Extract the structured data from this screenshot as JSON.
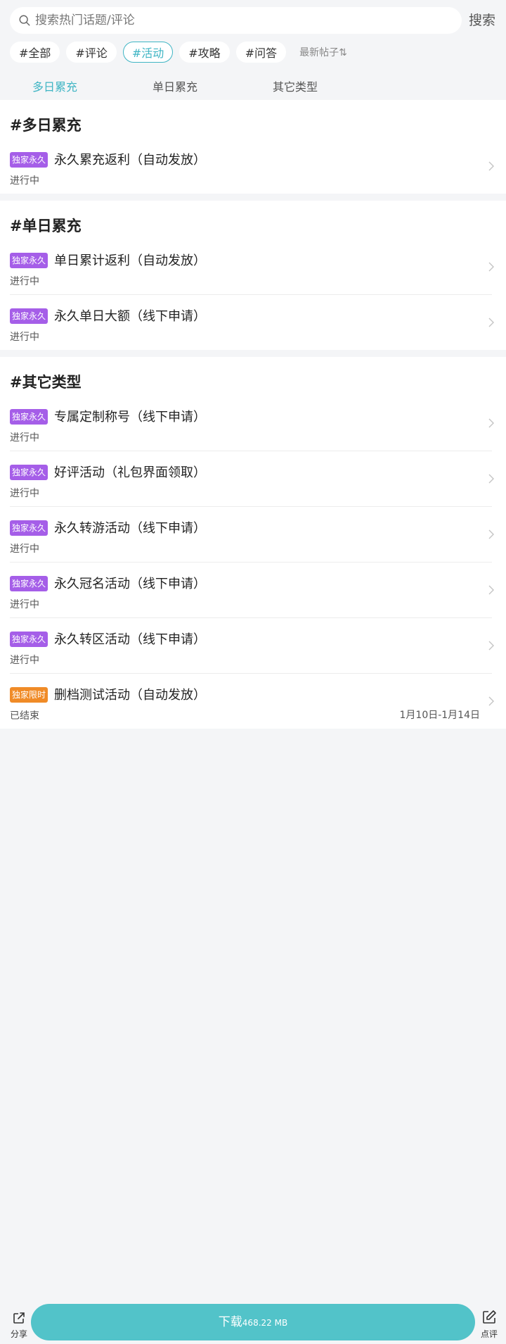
{
  "search": {
    "placeholder": "搜索热门话题/评论",
    "button": "搜索"
  },
  "tags": [
    {
      "label": "#全部",
      "active": false
    },
    {
      "label": "#评论",
      "active": false
    },
    {
      "label": "#活动",
      "active": true
    },
    {
      "label": "#攻略",
      "active": false
    },
    {
      "label": "#问答",
      "active": false
    }
  ],
  "sort": {
    "label": "最新帖子⇅"
  },
  "subtabs": [
    {
      "label": "多日累充",
      "active": true
    },
    {
      "label": "单日累充",
      "active": false
    },
    {
      "label": "其它类型",
      "active": false
    }
  ],
  "sections": [
    {
      "title": "#多日累充",
      "items": [
        {
          "badge": "独家永久",
          "badge_color": "#a55ee8",
          "title": "永久累充返利（自动发放）",
          "status": "进行中",
          "date": ""
        }
      ]
    },
    {
      "title": "#单日累充",
      "items": [
        {
          "badge": "独家永久",
          "badge_color": "#a55ee8",
          "title": "单日累计返利（自动发放）",
          "status": "进行中",
          "date": ""
        },
        {
          "badge": "独家永久",
          "badge_color": "#a55ee8",
          "title": "永久单日大额（线下申请）",
          "status": "进行中",
          "date": ""
        }
      ]
    },
    {
      "title": "#其它类型",
      "items": [
        {
          "badge": "独家永久",
          "badge_color": "#a55ee8",
          "title": "专属定制称号（线下申请）",
          "status": "进行中",
          "date": ""
        },
        {
          "badge": "独家永久",
          "badge_color": "#a55ee8",
          "title": "好评活动（礼包界面领取）",
          "status": "进行中",
          "date": ""
        },
        {
          "badge": "独家永久",
          "badge_color": "#a55ee8",
          "title": "永久转游活动（线下申请）",
          "status": "进行中",
          "date": ""
        },
        {
          "badge": "独家永久",
          "badge_color": "#a55ee8",
          "title": "永久冠名活动（线下申请）",
          "status": "进行中",
          "date": ""
        },
        {
          "badge": "独家永久",
          "badge_color": "#a55ee8",
          "title": "永久转区活动（线下申请）",
          "status": "进行中",
          "date": ""
        },
        {
          "badge": "独家限时",
          "badge_color": "#f08b27",
          "title": "删档测试活动（自动发放）",
          "status": "已结束",
          "date": "1月10日-1月14日"
        }
      ]
    }
  ],
  "bottom": {
    "share": "分享",
    "download": "下载",
    "download_size": "468.22 MB",
    "review": "点评"
  }
}
